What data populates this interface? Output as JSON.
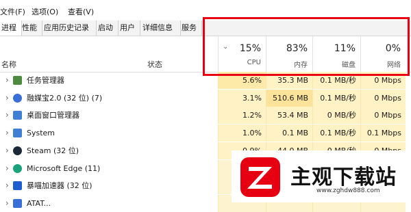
{
  "menu": [
    "文件(F)",
    "选项(O)",
    "查看(V)"
  ],
  "tabs": [
    "进程",
    "性能",
    "应用历史记录",
    "启动",
    "用户",
    "详细信息",
    "服务"
  ],
  "header": {
    "name": "名称",
    "status": "状态",
    "cpu": {
      "pct": "15%",
      "label": "CPU"
    },
    "mem": {
      "pct": "83%",
      "label": "内存"
    },
    "disk": {
      "pct": "11%",
      "label": "磁盘"
    },
    "net": {
      "pct": "0%",
      "label": "网络"
    }
  },
  "rows": [
    {
      "name": "任务管理器",
      "cpu": "5.6%",
      "mem": "35.3 MB",
      "disk": "0.1 MB/秒",
      "net": "0 Mbps",
      "icon": "task-manager-icon"
    },
    {
      "name": "融媒宝2.0 (32 位) (7)",
      "cpu": "3.1%",
      "mem": "510.6 MB",
      "disk": "0.1 MB/秒",
      "net": "0 Mbps",
      "icon": "app-d-icon"
    },
    {
      "name": "桌面窗口管理器",
      "cpu": "1.2%",
      "mem": "53.4 MB",
      "disk": "0 MB/秒",
      "net": "0 Mbps",
      "icon": "window-icon"
    },
    {
      "name": "System",
      "cpu": "1.0%",
      "mem": "0.1 MB",
      "disk": "0.1 MB/秒",
      "net": "0.1 Mbps",
      "icon": "window-icon"
    },
    {
      "name": "Steam (32 位)",
      "cpu": "0.9%",
      "mem": "44.0 MB",
      "disk": "0 MB/秒",
      "net": "0 Mbps",
      "icon": "steam-icon"
    },
    {
      "name": "Microsoft Edge (11)",
      "cpu": "",
      "mem": "",
      "disk": "",
      "net": "",
      "icon": "edge-icon"
    },
    {
      "name": "暴喵加速器 (32 位)",
      "cpu": "",
      "mem": "",
      "disk": "",
      "net": "",
      "icon": "accelerator-icon"
    },
    {
      "name": "ATAT...",
      "cpu": "",
      "mem": "",
      "disk": "",
      "net": "",
      "icon": "app-icon"
    }
  ],
  "watermark": {
    "text": "主观下载站",
    "url": "www.zghdw888.com"
  },
  "colors": {
    "highlight": "#e60012",
    "heat_low": "#fff4c4",
    "heat_mid": "#ffe8a0",
    "heat_high": "#fde39a"
  }
}
